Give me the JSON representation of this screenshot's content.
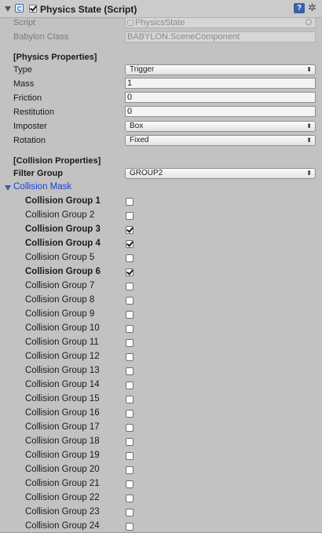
{
  "header": {
    "title": "Physics State (Script)",
    "enabled": true
  },
  "script_row": {
    "label": "Script",
    "value": "PhysicsState"
  },
  "babylon_row": {
    "label": "Babylon Class",
    "value": "BABYLON.SceneComponent"
  },
  "physics": {
    "section_title": "[Physics Properties]",
    "type": {
      "label": "Type",
      "value": "Trigger"
    },
    "mass": {
      "label": "Mass",
      "value": "1"
    },
    "friction": {
      "label": "Friction",
      "value": "0"
    },
    "restitution": {
      "label": "Restitution",
      "value": "0"
    },
    "imposter": {
      "label": "Imposter",
      "value": "Box"
    },
    "rotation": {
      "label": "Rotation",
      "value": "Fixed"
    }
  },
  "collision": {
    "section_title": "[Collision Properties]",
    "filter_group": {
      "label": "Filter Group",
      "value": "GROUP2"
    },
    "mask_label": "Collision Mask",
    "groups": [
      {
        "label": "Collision Group 1",
        "checked": false,
        "bold": true
      },
      {
        "label": "Collision Group 2",
        "checked": false,
        "bold": false
      },
      {
        "label": "Collision Group 3",
        "checked": true,
        "bold": true
      },
      {
        "label": "Collision Group 4",
        "checked": true,
        "bold": true
      },
      {
        "label": "Collision Group 5",
        "checked": false,
        "bold": false
      },
      {
        "label": "Collision Group 6",
        "checked": true,
        "bold": true
      },
      {
        "label": "Collision Group 7",
        "checked": false,
        "bold": false
      },
      {
        "label": "Collision Group 8",
        "checked": false,
        "bold": false
      },
      {
        "label": "Collision Group 9",
        "checked": false,
        "bold": false
      },
      {
        "label": "Collision Group 10",
        "checked": false,
        "bold": false
      },
      {
        "label": "Collision Group 11",
        "checked": false,
        "bold": false
      },
      {
        "label": "Collision Group 12",
        "checked": false,
        "bold": false
      },
      {
        "label": "Collision Group 13",
        "checked": false,
        "bold": false
      },
      {
        "label": "Collision Group 14",
        "checked": false,
        "bold": false
      },
      {
        "label": "Collision Group 15",
        "checked": false,
        "bold": false
      },
      {
        "label": "Collision Group 16",
        "checked": false,
        "bold": false
      },
      {
        "label": "Collision Group 17",
        "checked": false,
        "bold": false
      },
      {
        "label": "Collision Group 18",
        "checked": false,
        "bold": false
      },
      {
        "label": "Collision Group 19",
        "checked": false,
        "bold": false
      },
      {
        "label": "Collision Group 20",
        "checked": false,
        "bold": false
      },
      {
        "label": "Collision Group 21",
        "checked": false,
        "bold": false
      },
      {
        "label": "Collision Group 22",
        "checked": false,
        "bold": false
      },
      {
        "label": "Collision Group 23",
        "checked": false,
        "bold": false
      },
      {
        "label": "Collision Group 24",
        "checked": false,
        "bold": false
      }
    ]
  },
  "icons": {
    "foldout": "triangle-down-icon",
    "script": "script-icon",
    "help": "help-icon",
    "settings": "gear-icon",
    "object_picker": "circle-target-icon",
    "dropdown": "updown-arrows-icon"
  },
  "colors": {
    "panel_bg": "#c2c2c2",
    "mask_label": "#1a3fd6",
    "help_icon": "#3a5ea8"
  }
}
